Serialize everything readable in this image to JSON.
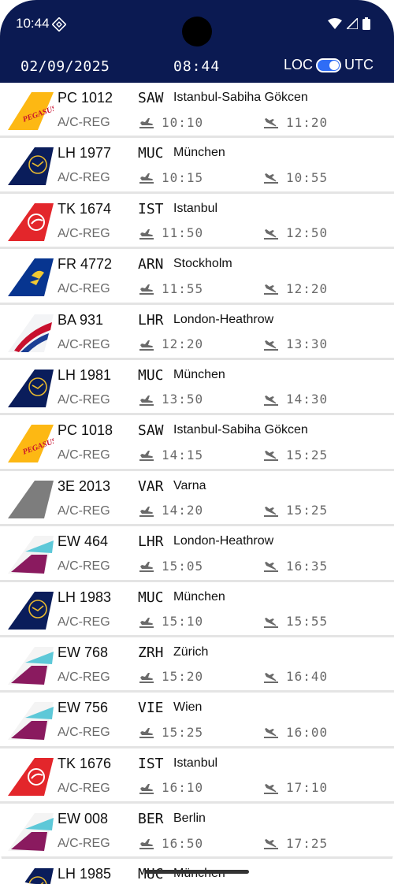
{
  "status": {
    "time": "10:44"
  },
  "header": {
    "date": "02/09/2025",
    "time": "08:44",
    "toggle_left": "LOC",
    "toggle_right": "UTC"
  },
  "colors": {
    "header_bg": "#0b1a52",
    "toggle_on": "#2f6df6"
  },
  "flights": [
    {
      "airline": "pegasus",
      "flight": "PC 1012",
      "reg": "A/C-REG",
      "iata": "SAW",
      "city": "Istanbul-Sabiha Gökcen",
      "dep": "10:10",
      "arr": "11:20"
    },
    {
      "airline": "lufthansa",
      "flight": "LH 1977",
      "reg": "A/C-REG",
      "iata": "MUC",
      "city": "München",
      "dep": "10:15",
      "arr": "10:55"
    },
    {
      "airline": "turkish",
      "flight": "TK 1674",
      "reg": "A/C-REG",
      "iata": "IST",
      "city": "Istanbul",
      "dep": "11:50",
      "arr": "12:50"
    },
    {
      "airline": "ryanair",
      "flight": "FR 4772",
      "reg": "A/C-REG",
      "iata": "ARN",
      "city": "Stockholm",
      "dep": "11:55",
      "arr": "12:20"
    },
    {
      "airline": "british",
      "flight": "BA 931",
      "reg": "A/C-REG",
      "iata": "LHR",
      "city": "London-Heathrow",
      "dep": "12:20",
      "arr": "13:30"
    },
    {
      "airline": "lufthansa",
      "flight": "LH 1981",
      "reg": "A/C-REG",
      "iata": "MUC",
      "city": "München",
      "dep": "13:50",
      "arr": "14:30"
    },
    {
      "airline": "pegasus",
      "flight": "PC 1018",
      "reg": "A/C-REG",
      "iata": "SAW",
      "city": "Istanbul-Sabiha Gökcen",
      "dep": "14:15",
      "arr": "15:25"
    },
    {
      "airline": "generic",
      "flight": "3E 2013",
      "reg": "A/C-REG",
      "iata": "VAR",
      "city": "Varna",
      "dep": "14:20",
      "arr": "15:25"
    },
    {
      "airline": "eurowings",
      "flight": "EW 464",
      "reg": "A/C-REG",
      "iata": "LHR",
      "city": "London-Heathrow",
      "dep": "15:05",
      "arr": "16:35"
    },
    {
      "airline": "lufthansa",
      "flight": "LH 1983",
      "reg": "A/C-REG",
      "iata": "MUC",
      "city": "München",
      "dep": "15:10",
      "arr": "15:55"
    },
    {
      "airline": "eurowings",
      "flight": "EW 768",
      "reg": "A/C-REG",
      "iata": "ZRH",
      "city": "Zürich",
      "dep": "15:20",
      "arr": "16:40"
    },
    {
      "airline": "eurowings",
      "flight": "EW 756",
      "reg": "A/C-REG",
      "iata": "VIE",
      "city": "Wien",
      "dep": "15:25",
      "arr": "16:00"
    },
    {
      "airline": "turkish",
      "flight": "TK 1676",
      "reg": "A/C-REG",
      "iata": "IST",
      "city": "Istanbul",
      "dep": "16:10",
      "arr": "17:10"
    },
    {
      "airline": "eurowings",
      "flight": "EW 008",
      "reg": "A/C-REG",
      "iata": "BER",
      "city": "Berlin",
      "dep": "16:50",
      "arr": "17:25"
    },
    {
      "airline": "lufthansa",
      "flight": "LH 1985",
      "reg": "",
      "iata": "MUC",
      "city": "München",
      "dep": "",
      "arr": ""
    }
  ],
  "tail_labels": {
    "pegasus": "PEGASUS"
  }
}
